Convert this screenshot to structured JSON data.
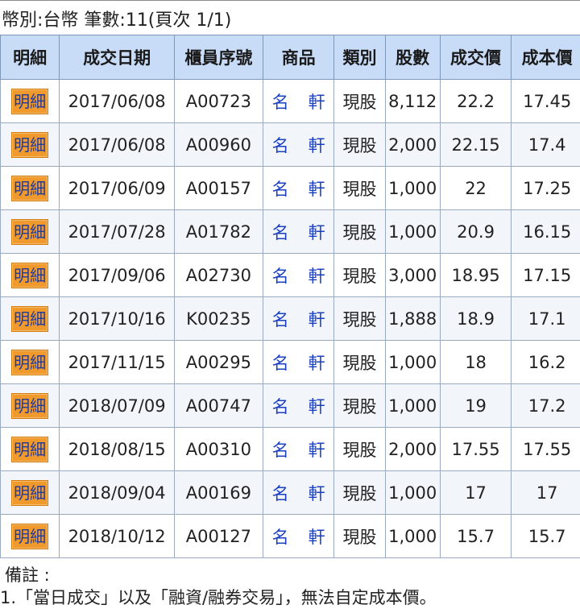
{
  "summary": "幣別:台幣 筆數:11(頁次 1/1)",
  "table": {
    "headers": [
      "明細",
      "成交日期",
      "櫃員序號",
      "商品",
      "類別",
      "股數",
      "成交價",
      "成本價"
    ],
    "detail_label": "明細",
    "rows": [
      {
        "date": "2017/06/08",
        "teller": "A00723",
        "product": [
          "名",
          "軒"
        ],
        "type": "現股",
        "shares": "8,112",
        "price": "22.2",
        "cost": "17.45"
      },
      {
        "date": "2017/06/08",
        "teller": "A00960",
        "product": [
          "名",
          "軒"
        ],
        "type": "現股",
        "shares": "2,000",
        "price": "22.15",
        "cost": "17.4"
      },
      {
        "date": "2017/06/09",
        "teller": "A00157",
        "product": [
          "名",
          "軒"
        ],
        "type": "現股",
        "shares": "1,000",
        "price": "22",
        "cost": "17.25"
      },
      {
        "date": "2017/07/28",
        "teller": "A01782",
        "product": [
          "名",
          "軒"
        ],
        "type": "現股",
        "shares": "1,000",
        "price": "20.9",
        "cost": "16.15"
      },
      {
        "date": "2017/09/06",
        "teller": "A02730",
        "product": [
          "名",
          "軒"
        ],
        "type": "現股",
        "shares": "3,000",
        "price": "18.95",
        "cost": "17.15"
      },
      {
        "date": "2017/10/16",
        "teller": "K00235",
        "product": [
          "名",
          "軒"
        ],
        "type": "現股",
        "shares": "1,888",
        "price": "18.9",
        "cost": "17.1"
      },
      {
        "date": "2017/11/15",
        "teller": "A00295",
        "product": [
          "名",
          "軒"
        ],
        "type": "現股",
        "shares": "1,000",
        "price": "18",
        "cost": "16.2"
      },
      {
        "date": "2018/07/09",
        "teller": "A00747",
        "product": [
          "名",
          "軒"
        ],
        "type": "現股",
        "shares": "1,000",
        "price": "19",
        "cost": "17.2"
      },
      {
        "date": "2018/08/15",
        "teller": "A00310",
        "product": [
          "名",
          "軒"
        ],
        "type": "現股",
        "shares": "2,000",
        "price": "17.55",
        "cost": "17.55"
      },
      {
        "date": "2018/09/04",
        "teller": "A00169",
        "product": [
          "名",
          "軒"
        ],
        "type": "現股",
        "shares": "1,000",
        "price": "17",
        "cost": "17"
      },
      {
        "date": "2018/10/12",
        "teller": "A00127",
        "product": [
          "名",
          "軒"
        ],
        "type": "現股",
        "shares": "1,000",
        "price": "15.7",
        "cost": "15.7"
      }
    ]
  },
  "notes": {
    "label": "備註 :",
    "line1": "1.「當日成交」以及「融資/融券交易」，無法自定成本價。"
  },
  "colors": {
    "header_bg": "#c8dcf8",
    "button_bg": "#f09a2e",
    "link": "#1b3fbf"
  }
}
